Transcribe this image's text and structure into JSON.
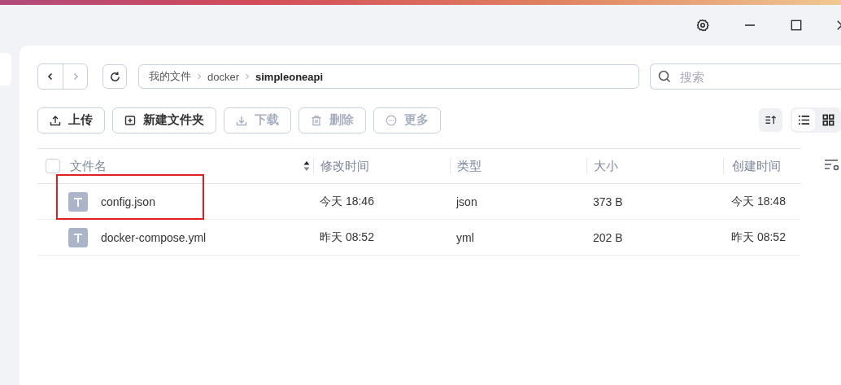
{
  "nav": {
    "back_disabled": false,
    "forward_disabled": true
  },
  "breadcrumb": [
    {
      "label": "我的文件",
      "current": false
    },
    {
      "label": "docker",
      "current": false
    },
    {
      "label": "simpleoneapi",
      "current": true
    }
  ],
  "search": {
    "placeholder": "搜索"
  },
  "actions": [
    {
      "kind": "upload",
      "label": "上传",
      "disabled": false
    },
    {
      "kind": "new-folder",
      "label": "新建文件夹",
      "disabled": false
    },
    {
      "kind": "download",
      "label": "下载",
      "disabled": true
    },
    {
      "kind": "delete",
      "label": "删除",
      "disabled": true
    },
    {
      "kind": "more",
      "label": "更多",
      "disabled": true
    }
  ],
  "views": [
    {
      "kind": "list",
      "selected": true
    },
    {
      "kind": "grid",
      "selected": false
    }
  ],
  "table": {
    "select_all": {
      "checked": false
    },
    "columns": [
      "文件名",
      "修改时间",
      "类型",
      "大小",
      "创建时间"
    ],
    "rows": [
      {
        "name": "config.json",
        "modified": "今天 18:46",
        "type": "json",
        "size": "373 B",
        "created": "今天 18:48",
        "highlighted": true
      },
      {
        "name": "docker-compose.yml",
        "modified": "昨天 08:52",
        "type": "yml",
        "size": "202 B",
        "created": "昨天 08:52",
        "highlighted": false
      }
    ]
  }
}
